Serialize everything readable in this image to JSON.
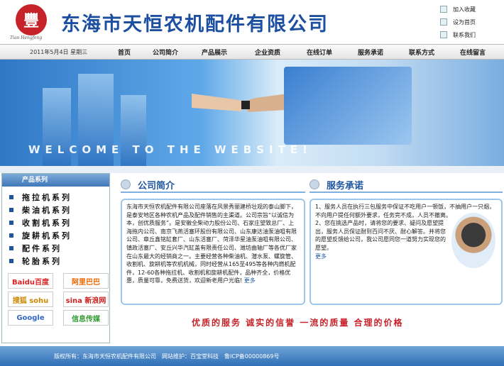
{
  "header": {
    "logo_char": "豐",
    "logo_sub": "Tian Hengfeng",
    "company": "东海市天恒农机配件有限公司"
  },
  "quick_links": [
    {
      "label": "加入收藏",
      "icon": "bookmark-icon"
    },
    {
      "label": "设为首页",
      "icon": "home-icon"
    },
    {
      "label": "联系我们",
      "icon": "contact-icon"
    }
  ],
  "nav": {
    "date": "2011年5月4日  星期三",
    "items": [
      "首页",
      "公司简介",
      "产品展示",
      "企业资质",
      "在线订单",
      "服务承诺",
      "联系方式",
      "在线留言"
    ]
  },
  "banner": {
    "welcome": "WELCOME TO THE WEBSITE!"
  },
  "sidebar": {
    "title": "产品系列",
    "items": [
      "拖拉机系列",
      "柴油机系列",
      "收割机系列",
      "旋耕机系列",
      "配件系列",
      "轮胎系列"
    ],
    "partners": [
      "Baidu百度",
      "阿里巴巴",
      "搜狐 sohu",
      "sina 新浪网",
      "Google",
      "信息传媒"
    ]
  },
  "about": {
    "title": "公司简介",
    "text": "东海市天恒农机配件有限公司座落在风景秀丽建桥壮观的泰山脚下，是泰安地区各种农机产品及配件销售的主渠道。公司宗旨“以诚信为本，创优质服务”。是安徽全柴动力股份公司、石家庄望致总厂、上海拖内公司、南京飞燕活塞环股份有限公司、山东康达油泵油咀有限公司、章丘鑫铭缸套厂、山东活塞厂、菏泽华星油泵油咀有限公司、镇政活塞厂、安丘兴华汽缸盖有限责任公司、潍坊曲轴厂等各优厂家在山东最大的经销商之一。主要经营各种柴油机、潜水泵、螺旋管、收割机、旋耕机等农机机械，同时经营从165至495等各种内燃机配件，12-60各种拖拉机、收割机和旋耕机配件，品种齐全，价格优惠，质量可靠，免费送货，欢迎新老用户光临!",
    "more": "更多"
  },
  "service": {
    "title": "服务承诺",
    "text1": "1、服务人员在执行三包服务中保证不吃用户一顿饭，不抽用户一只烟，不向用户提任何额外要求，任务完不成，人员不撤离。",
    "text2": "2、您在挑选产品时，请将您的要求、疑问及愿望提出，服务人员保证耐到百问不厌、耐心解答。并将您的愿望反馈给公司，我公司愿同您一道努力实现您的愿望。",
    "more": "更多"
  },
  "slogan": "优质的服务  诚实的信誉  一流的质量  合理的价格",
  "footer": {
    "copyright": "版权所有：东海市天恒农机配件有限公司",
    "maint": "网站维护：百宝堂科技",
    "icp": "鲁ICP备00000869号"
  },
  "colors": {
    "brand_blue": "#1c4fa0",
    "brand_red": "#c6222a"
  }
}
